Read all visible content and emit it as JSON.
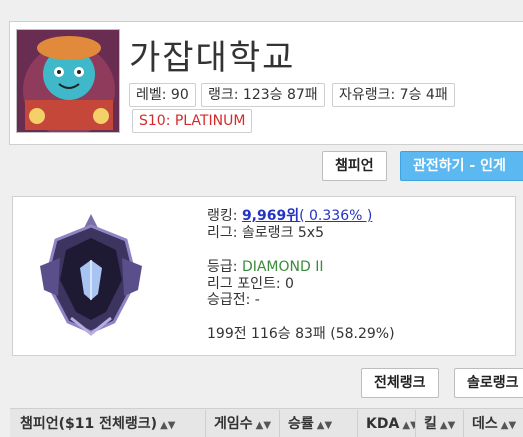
{
  "profile": {
    "name": "가잡대학교",
    "level": "레벨: 90",
    "rank_record": "랭크: 123승 87패",
    "flex_record": "자유랭크: 7승 4패",
    "season_tier": "S10: PLATINUM",
    "avatar_icon": "champion-portrait-icon"
  },
  "actions": {
    "champion_button": "챔피언",
    "spectate_button": "관전하기 - 인게"
  },
  "rank": {
    "emblem_icon": "diamond-emblem-icon",
    "ranking_label": "랭킹: ",
    "ranking_value": "9,969위",
    "ranking_pct": "( 0.336% )",
    "league_line": "리그: 솔로랭크 5x5",
    "tier_label": "등급: ",
    "tier_value": "DIAMOND II",
    "points_line": "리그 포인트: 0",
    "promo_line": "승급전: -",
    "record_line": "199전 116승 83패 (58.29%)"
  },
  "filters": {
    "all_rank": "전체랭크",
    "solo_rank": "솔로랭크"
  },
  "table": {
    "columns": [
      "챔피언($11 전체랭크)",
      "게임수",
      "승률",
      "KDA",
      "킬",
      "데스"
    ],
    "sort_icon": "sort-arrows-icon"
  },
  "colors": {
    "primary_button": "#5bb8f0",
    "season_text": "#d62a2a",
    "link": "#2433c4",
    "tier_green": "#3a8b3a"
  }
}
